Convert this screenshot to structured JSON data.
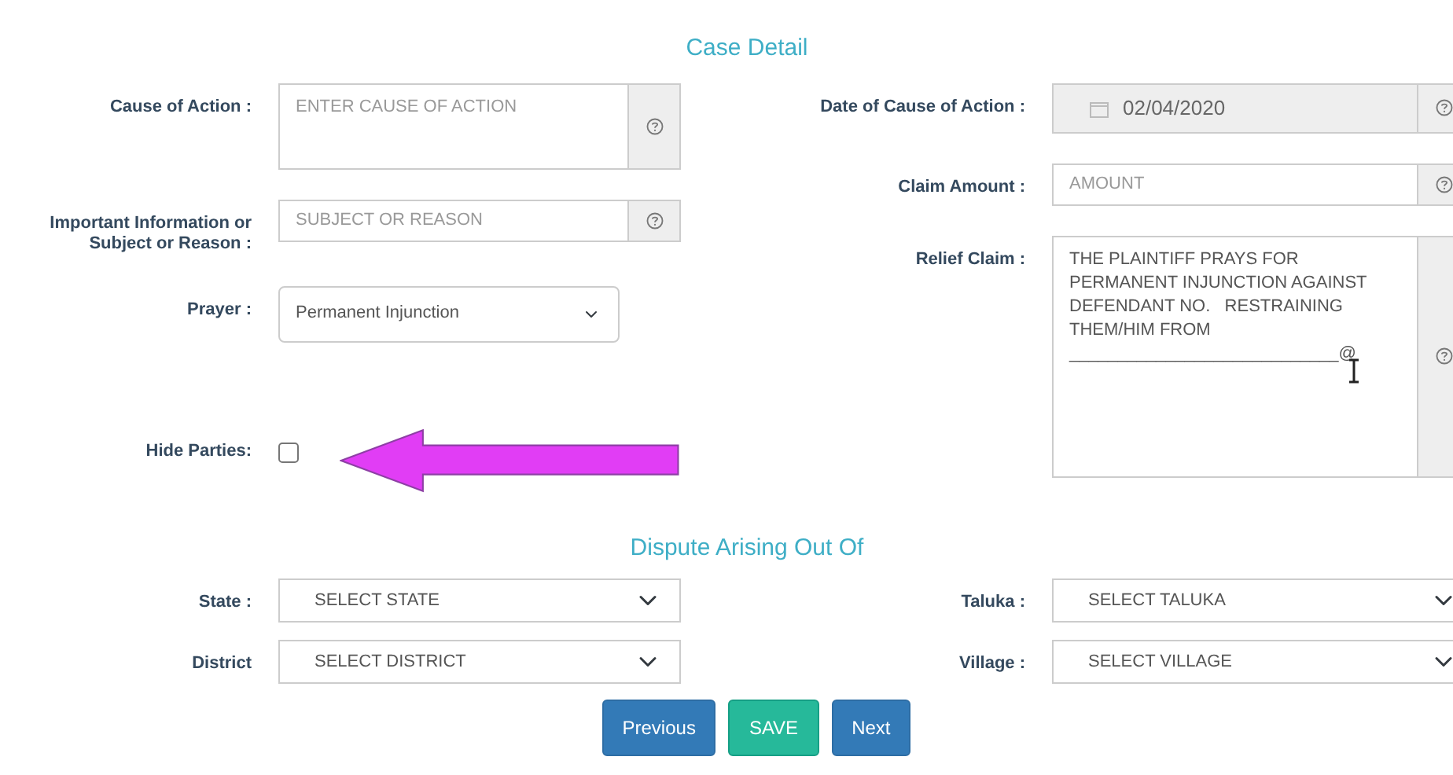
{
  "case_detail": {
    "title": "Case Detail",
    "left_fields": [
      {
        "kind": "textarea",
        "label": "Cause of Action :",
        "placeholder": "ENTER CAUSE OF ACTION",
        "help": true
      },
      {
        "kind": "input",
        "label": "Important Information or Subject or Reason :",
        "placeholder": "SUBJECT OR REASON",
        "help": true
      },
      {
        "kind": "select",
        "label": "Prayer :",
        "value": "Permanent Injunction"
      },
      {
        "kind": "checkbox",
        "label": "Hide Parties:",
        "checked": false
      }
    ],
    "right_fields": [
      {
        "kind": "date",
        "label": "Date of Cause of Action :",
        "value": "02/04/2020",
        "disabled": true,
        "help": true
      },
      {
        "kind": "input",
        "label": "Claim Amount :",
        "placeholder": "AMOUNT",
        "help": true
      },
      {
        "kind": "textarea",
        "label": "Relief Claim :",
        "value": "THE PLAINTIFF PRAYS FOR PERMANENT INJUNCTION AGAINST DEFENDANT NO.   RESTRAINING THEM/HIM FROM ____________________________@",
        "help": true
      }
    ]
  },
  "dispute": {
    "title": "Dispute Arising Out Of",
    "rows": [
      [
        {
          "label": "State :",
          "value": "SELECT STATE"
        },
        {
          "label": "Taluka :",
          "value": "SELECT TALUKA"
        }
      ],
      [
        {
          "label": "District",
          "value": "SELECT DISTRICT"
        },
        {
          "label": "Village :",
          "value": "SELECT VILLAGE"
        }
      ]
    ]
  },
  "buttons": [
    {
      "label": "Previous",
      "kind": "primary"
    },
    {
      "label": "SAVE",
      "kind": "success"
    },
    {
      "label": "Next",
      "kind": "primary"
    }
  ]
}
